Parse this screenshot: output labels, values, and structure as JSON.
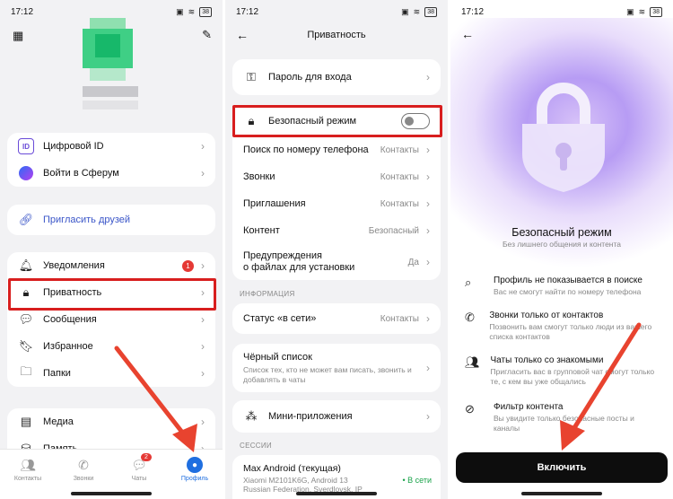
{
  "status_time": "17:12",
  "battery": "38",
  "profile": {
    "menu_group1": [
      {
        "label": "Цифровой ID"
      },
      {
        "label": "Войти в Сферум"
      }
    ],
    "invite": "Пригласить друзей",
    "menu_group2": [
      {
        "label": "Уведомления",
        "badge": "1"
      },
      {
        "label": "Приватность"
      },
      {
        "label": "Сообщения"
      },
      {
        "label": "Избранное"
      },
      {
        "label": "Папки"
      }
    ],
    "menu_group3": [
      {
        "label": "Медиа"
      },
      {
        "label": "Память"
      }
    ],
    "tabs": [
      {
        "label": "Контакты",
        "icon": "contacts-icon"
      },
      {
        "label": "Звонки",
        "icon": "phone-icon"
      },
      {
        "label": "Чаты",
        "icon": "chat-icon",
        "badge": "2"
      },
      {
        "label": "Профиль",
        "icon": "profile-icon"
      }
    ]
  },
  "privacy": {
    "title": "Приватность",
    "password": "Пароль для входа",
    "safe_mode": "Безопасный режим",
    "rows": [
      {
        "label": "Поиск по номеру телефона",
        "value": "Контакты"
      },
      {
        "label": "Звонки",
        "value": "Контакты"
      },
      {
        "label": "Приглашения",
        "value": "Контакты"
      },
      {
        "label": "Контент",
        "value": "Безопасный"
      }
    ],
    "warnings_line1": "Предупреждения",
    "warnings_line2": "о файлах для установки",
    "warnings_value": "Да",
    "info_caption": "ИНФОРМАЦИЯ",
    "online_status": "Статус «в сети»",
    "online_value": "Контакты",
    "blacklist_title": "Чёрный список",
    "blacklist_desc": "Список тех, кто не может вам писать, звонить и добавлять в чаты",
    "miniapps": "Мини-приложения",
    "sessions_caption": "СЕССИИ",
    "session_title": "Max Android (текущая)",
    "session_line1": "Xiaomi M2101K6G, Android 13",
    "session_line2": "Russian Federation, Sverdlovsk, IP",
    "session_status": "• В сети"
  },
  "safe": {
    "title": "Безопасный режим",
    "subtitle": "Без лишнего общения и контента",
    "features": [
      {
        "icon": "search-icon",
        "title": "Профиль не показывается в поиске",
        "desc": "Вас не смогут найти по номеру телефона"
      },
      {
        "icon": "phone-icon",
        "title": "Звонки только от контактов",
        "desc": "Позвонить вам смогут только люди из вашего списка контактов"
      },
      {
        "icon": "people-icon",
        "title": "Чаты только со знакомыми",
        "desc": "Пригласить вас в групповой чат смогут только те, с кем вы уже общались"
      },
      {
        "icon": "eye-off-icon",
        "title": "Фильтр контента",
        "desc": "Вы увидите только безопасные посты и каналы"
      }
    ],
    "enable_button": "Включить"
  },
  "colors": {
    "highlight": "#d81e1e",
    "accent": "#1f6fe0",
    "link": "#3a55c8"
  }
}
